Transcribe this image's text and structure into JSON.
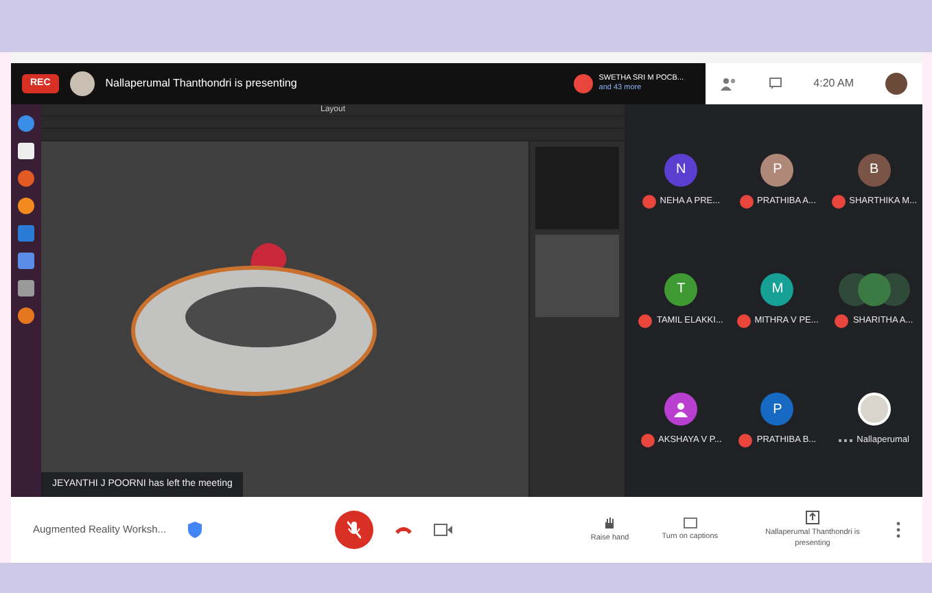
{
  "meet_header": {
    "rec_label": "REC",
    "presenter_banner": "Nallaperumal Thanthondri is presenting",
    "participants": {
      "names": "SWETHA SRI M POCB...",
      "more": "and 43 more"
    },
    "time": "4:20 AM"
  },
  "shared_screen": {
    "app_title": "Layout",
    "notification": "JEYANTHI J POORNI has left the meeting"
  },
  "tiles": [
    {
      "name": "NEHA A PRE...",
      "kind": "initial",
      "initial": "N",
      "color": "#5b3fd1",
      "muted": true
    },
    {
      "name": "PRATHIBA A...",
      "kind": "initial",
      "initial": "P",
      "color": "#b08878",
      "muted": true
    },
    {
      "name": "SHARTHIKA M...",
      "kind": "initial",
      "initial": "B",
      "color": "#7a5446",
      "muted": true
    },
    {
      "name": "TAMIL ELAKKI...",
      "kind": "initial",
      "initial": "T",
      "color": "#3f9a34",
      "muted": true
    },
    {
      "name": "MITHRA V PE...",
      "kind": "initial",
      "initial": "M",
      "color": "#17a096",
      "muted": true
    },
    {
      "name": "SHARITHA A...",
      "kind": "group",
      "color": "#3c7a44",
      "muted": true
    },
    {
      "name": "AKSHAYA V P...",
      "kind": "person",
      "color": "#b83fcf",
      "muted": true
    },
    {
      "name": "PRATHIBA B...",
      "kind": "initial",
      "initial": "P",
      "color": "#1769c2",
      "muted": true
    },
    {
      "name": "Nallaperumal",
      "kind": "photo",
      "color": "#d9d4cc",
      "muted": false
    }
  ],
  "bottom_bar": {
    "meeting_title": "Augmented Reality Worksh...",
    "mic_muted": true,
    "actions": [
      {
        "label": "Raise hand",
        "kind": "hand"
      },
      {
        "label": "Turn on captions",
        "kind": "captions"
      },
      {
        "label": "Nallaperumal Thanthondri is presenting",
        "kind": "present"
      }
    ]
  }
}
